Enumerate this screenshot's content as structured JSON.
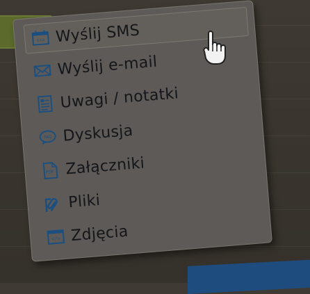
{
  "context_menu": {
    "items": [
      {
        "label": "Wyślij SMS",
        "icon": "sms-calendar-icon"
      },
      {
        "label": "Wyślij e-mail",
        "icon": "envelope-icon"
      },
      {
        "label": "Uwagi / notatki",
        "icon": "note-icon"
      },
      {
        "label": "Dyskusja",
        "icon": "chat-bubble-icon"
      },
      {
        "label": "Załączniki",
        "icon": "pdf-file-icon"
      },
      {
        "label": "Pliki",
        "icon": "paperclip-icon"
      },
      {
        "label": "Zdjęcia",
        "icon": "image-icon"
      }
    ],
    "active_index": 0
  },
  "colors": {
    "menu_bg": "#5d5a57",
    "icon_blue": "#1b4f80",
    "bottom_bar": "#1f4c7e"
  }
}
